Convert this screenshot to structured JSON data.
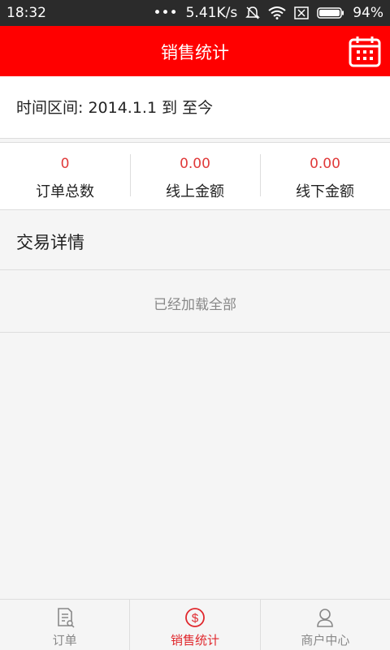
{
  "status_bar": {
    "time": "18:32",
    "network_speed": "5.41K/s",
    "battery": "94%"
  },
  "header": {
    "title": "销售统计",
    "calendar_icon": "calendar-icon"
  },
  "date_range": {
    "text": "时间区间: 2014.1.1 到 至今"
  },
  "stats": [
    {
      "value": "0",
      "label": "订单总数"
    },
    {
      "value": "0.00",
      "label": "线上金额"
    },
    {
      "value": "0.00",
      "label": "线下金额"
    }
  ],
  "details": {
    "title": "交易详情",
    "loaded_text": "已经加载全部"
  },
  "tabs": [
    {
      "label": "订单",
      "icon": "order-icon",
      "active": false
    },
    {
      "label": "销售统计",
      "icon": "dollar-icon",
      "active": true
    },
    {
      "label": "商户中心",
      "icon": "user-icon",
      "active": false
    }
  ],
  "colors": {
    "header_bg": "#ff0000",
    "stat_value": "#e03a3a",
    "tab_active": "#e0282d",
    "tab_inactive": "#888888"
  }
}
